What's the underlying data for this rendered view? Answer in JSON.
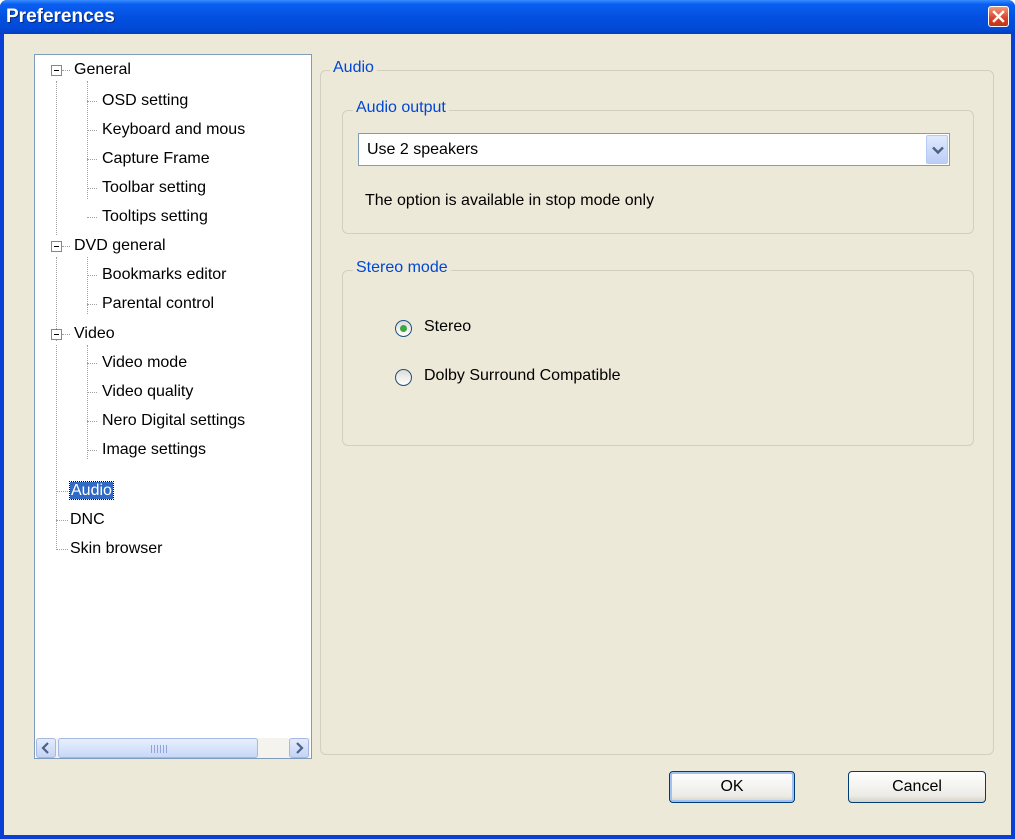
{
  "window": {
    "title": "Preferences"
  },
  "tree": {
    "items": [
      {
        "label": "General",
        "expandable": true
      },
      {
        "label": "OSD setting"
      },
      {
        "label": "Keyboard and mous"
      },
      {
        "label": "Capture Frame"
      },
      {
        "label": "Toolbar setting"
      },
      {
        "label": "Tooltips setting"
      },
      {
        "label": "DVD general",
        "expandable": true
      },
      {
        "label": "Bookmarks editor"
      },
      {
        "label": "Parental control"
      },
      {
        "label": "Video",
        "expandable": true
      },
      {
        "label": "Video mode"
      },
      {
        "label": "Video quality"
      },
      {
        "label": "Nero Digital settings"
      },
      {
        "label": "Image settings"
      },
      {
        "label": "Audio",
        "selected": true
      },
      {
        "label": "DNC"
      },
      {
        "label": "Skin browser"
      }
    ]
  },
  "audio_group": {
    "legend": "Audio"
  },
  "audio_output": {
    "legend": "Audio output",
    "selected": "Use 2 speakers",
    "note": "The option is available in stop mode only"
  },
  "stereo_mode": {
    "legend": "Stereo mode",
    "options": [
      {
        "label": "Stereo",
        "checked": true
      },
      {
        "label": "Dolby Surround Compatible",
        "checked": false
      }
    ]
  },
  "buttons": {
    "ok": "OK",
    "cancel": "Cancel"
  },
  "icons": {
    "close": "close-icon",
    "combo_arrow": "chevron-down-icon",
    "scroll_left": "arrow-left-icon",
    "scroll_right": "arrow-right-icon",
    "collapse": "minus-icon"
  },
  "colors": {
    "title_bar": "#0350e0",
    "selection": "#316ac5",
    "group_label": "#0046d5",
    "dialog_bg": "#ece9d8"
  }
}
